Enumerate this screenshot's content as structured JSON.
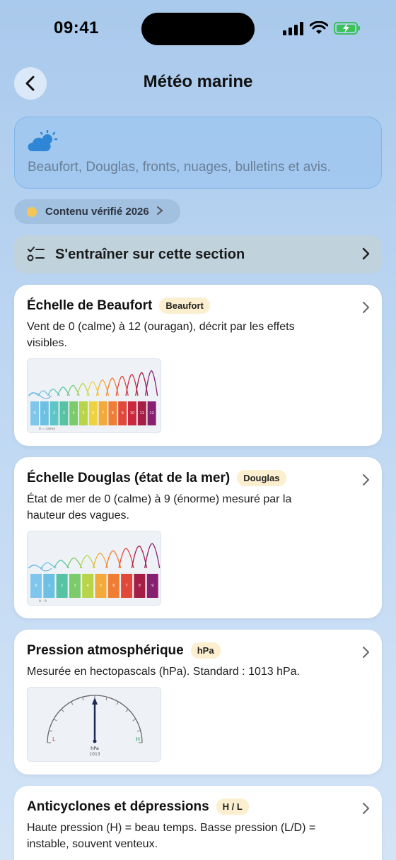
{
  "status": {
    "time": "09:41"
  },
  "nav": {
    "title": "Météo marine"
  },
  "intro": {
    "text": "Beaufort, Douglas, fronts, nuages, bulletins et avis."
  },
  "verified": {
    "label": "Contenu vérifié 2026"
  },
  "train": {
    "label": "S'entraîner sur cette section"
  },
  "cards": [
    {
      "title": "Échelle de Beaufort",
      "tag": "Beaufort",
      "description": "Vent de 0 (calme) à 12 (ouragan), décrit par les effets visibles.",
      "scale_labels": [
        "0",
        "1",
        "2",
        "3",
        "4",
        "5",
        "6",
        "7",
        "8",
        "9",
        "10",
        "11",
        "12"
      ],
      "scale_caption": "0 = calme"
    },
    {
      "title": "Échelle Douglas (état de la mer)",
      "tag": "Douglas",
      "description": "État de mer de 0 (calme) à 9 (énorme) mesuré par la hauteur des vagues.",
      "scale_labels": [
        "0",
        "1",
        "2",
        "3",
        "4",
        "5",
        "6",
        "7",
        "8",
        "9"
      ],
      "scale_caption": "0 – 9"
    },
    {
      "title": "Pression atmosphérique",
      "tag": "hPa",
      "description": "Mesurée en hectopascals (hPa). Standard : 1013 hPa.",
      "gauge_low": "L",
      "gauge_high": "H",
      "gauge_unit": "hPa",
      "gauge_value": "1013"
    },
    {
      "title": "Anticyclones et dépressions",
      "tag": "H / L",
      "description": "Haute pression (H) = beau temps. Basse pression (L/D) = instable, souvent venteux."
    }
  ],
  "colors": {
    "scale": [
      "#7fc6ec",
      "#6cc0e4",
      "#5ec6c6",
      "#57c3a3",
      "#7ccb6a",
      "#b8d54a",
      "#ecd33f",
      "#f4aa3a",
      "#ef7d35",
      "#e2483a",
      "#c9283f",
      "#a41e45",
      "#86206f"
    ],
    "accent_yellow": "#f4c654",
    "tag_bg": "#fbefcf"
  }
}
